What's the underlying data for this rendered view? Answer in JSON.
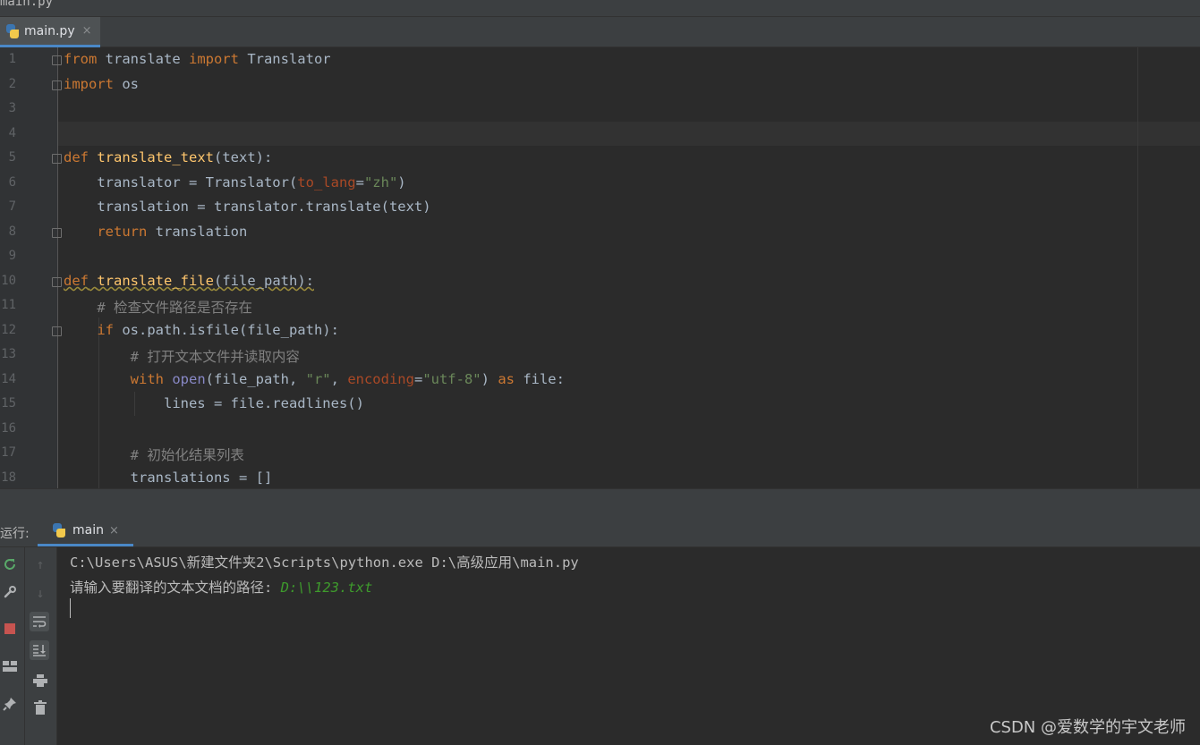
{
  "window": {
    "title": "main.py"
  },
  "editor_tab": {
    "label": "main.py",
    "close": "×"
  },
  "line_numbers": [
    "1",
    "2",
    "3",
    "4",
    "5",
    "6",
    "7",
    "8",
    "9",
    "10",
    "11",
    "12",
    "13",
    "14",
    "15",
    "16",
    "17",
    "18"
  ],
  "code": {
    "l1": {
      "k1": "from",
      "t1": " translate ",
      "k2": "import",
      "t2": " Translator"
    },
    "l2": {
      "k1": "import",
      "t1": " os"
    },
    "l5": {
      "k1": "def",
      "t1": " ",
      "fn": "translate_text",
      "t2": "(text):"
    },
    "l6": {
      "t1": "    translator = Translator(",
      "p1": "to_lang",
      "t2": "=",
      "s1": "\"zh\"",
      "t3": ")"
    },
    "l7": {
      "t1": "    translation = translator.translate(text)"
    },
    "l8": {
      "k1": "    return",
      "t1": " translation"
    },
    "l10": {
      "k1": "def",
      "t1": " ",
      "fn": "translate_file",
      "t2": "(file_path):"
    },
    "l11": {
      "c1": "    # 检查文件路径是否存在"
    },
    "l12": {
      "k1": "    if",
      "t1": " os.path.isfile(file_path):"
    },
    "l13": {
      "c1": "        # 打开文本文件并读取内容"
    },
    "l14": {
      "k1": "        with",
      "t1": " ",
      "b1": "open",
      "t2": "(file_path, ",
      "s1": "\"r\"",
      "t3": ", ",
      "p1": "encoding",
      "t4": "=",
      "s2": "\"utf-8\"",
      "t5": ") ",
      "k2": "as",
      "t6": " file:"
    },
    "l15": {
      "t1": "            lines = file.readlines()"
    },
    "l17": {
      "c1": "        # 初始化结果列表"
    },
    "l18": {
      "t1": "        translations = []"
    }
  },
  "run_panel": {
    "label": "运行:",
    "tab_label": "main",
    "tab_close": "×"
  },
  "console": {
    "line1": "C:\\Users\\ASUS\\新建文件夹2\\Scripts\\python.exe D:\\高级应用\\main.py",
    "prompt": "请输入要翻译的文本文档的路径: ",
    "user_input": "D:\\\\123.txt"
  },
  "left_tools": [
    "rerun-icon",
    "wrench-icon",
    "stop-icon",
    "layout-icon",
    "pin-icon"
  ],
  "console_tools": [
    "up-arrow-icon",
    "down-arrow-icon",
    "soft-wrap-icon",
    "scroll-to-end-icon",
    "print-icon",
    "trash-icon"
  ],
  "watermark": "CSDN @爱数学的宇文老师"
}
